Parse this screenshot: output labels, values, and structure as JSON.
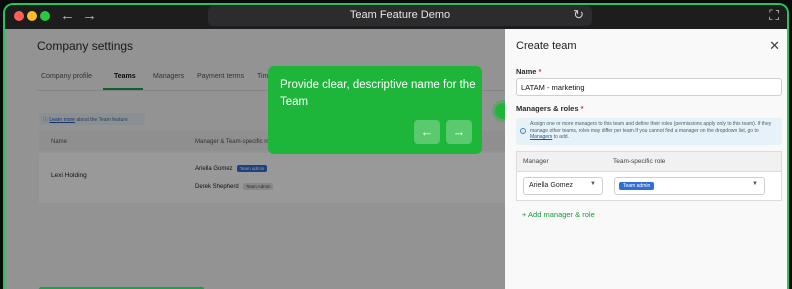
{
  "browser": {
    "title": "Team Feature Demo",
    "colors": {
      "close": "#ff5f57",
      "minimize": "#febc2e",
      "maximize": "#28c840",
      "accent": "#22c55e"
    }
  },
  "page": {
    "title": "Company settings",
    "tabs": [
      "Company profile",
      "Teams",
      "Managers",
      "Payment terms",
      "Time"
    ],
    "active_tab": "Teams",
    "info": {
      "link": "Learn more",
      "text": " about the Team feature"
    },
    "table": {
      "headers": [
        "Name",
        "Manager & Team-specific role"
      ],
      "rows": [
        {
          "name": "Lexi Holding",
          "managers": [
            {
              "name": "Ariella Gomez",
              "role": "Team admin"
            },
            {
              "name": "Derek Shepherd",
              "role": "Team Admin"
            }
          ]
        }
      ]
    }
  },
  "tooltip": {
    "text": "Provide clear, descriptive name for the Team",
    "prev_icon": "arrow-left-icon",
    "next_icon": "arrow-right-icon"
  },
  "panel": {
    "title": "Create team",
    "name_label": "Name",
    "name_value": "LATAM - marketing",
    "managers_label": "Managers & roles",
    "help": {
      "text1": "Assign one or more managers to this team and define their roles (permissions apply only to this team). If they manage other teams, roles may differ per team.If you cannot find a manager on the dropdown list, go to ",
      "link": "Managers",
      "text2": " to add."
    },
    "grid_headers": [
      "Manager",
      "Team-specific role"
    ],
    "manager_value": "Ariella Gomez",
    "role_value": "Team admin",
    "add_label": "+ Add manager & role"
  }
}
